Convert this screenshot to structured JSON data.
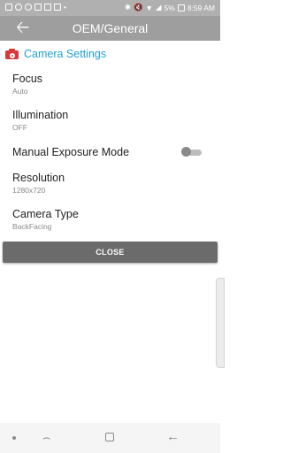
{
  "status_bar": {
    "battery": "5%",
    "time": "8:59 AM",
    "icons": [
      "notification-icon",
      "at-icon",
      "cloud-icon",
      "image-icon",
      "gmail-icon",
      "calendar-icon",
      "more-dots-icon",
      "bluetooth-icon",
      "mute-icon",
      "wifi-icon",
      "signal-icon",
      "battery-icon"
    ]
  },
  "app_bar": {
    "title": "OEM/General",
    "back_icon": "arrow-left-icon"
  },
  "section": {
    "title": "Camera Settings",
    "icon": "camera-icon",
    "accent_color": "#22a0d6",
    "icon_color": "#d9373a"
  },
  "settings": [
    {
      "title": "Focus",
      "value": "Auto"
    },
    {
      "title": "Illumination",
      "value": "OFF"
    },
    {
      "title": "Manual Exposure Mode",
      "toggle": false
    },
    {
      "title": "Resolution",
      "value": "1280x720"
    },
    {
      "title": "Camera Type",
      "value": "BackFacing"
    }
  ],
  "close_button": {
    "label": "CLOSE"
  },
  "nav_bar": {
    "icons": [
      "dot-icon",
      "recent-apps-icon",
      "home-icon",
      "back-icon"
    ]
  }
}
